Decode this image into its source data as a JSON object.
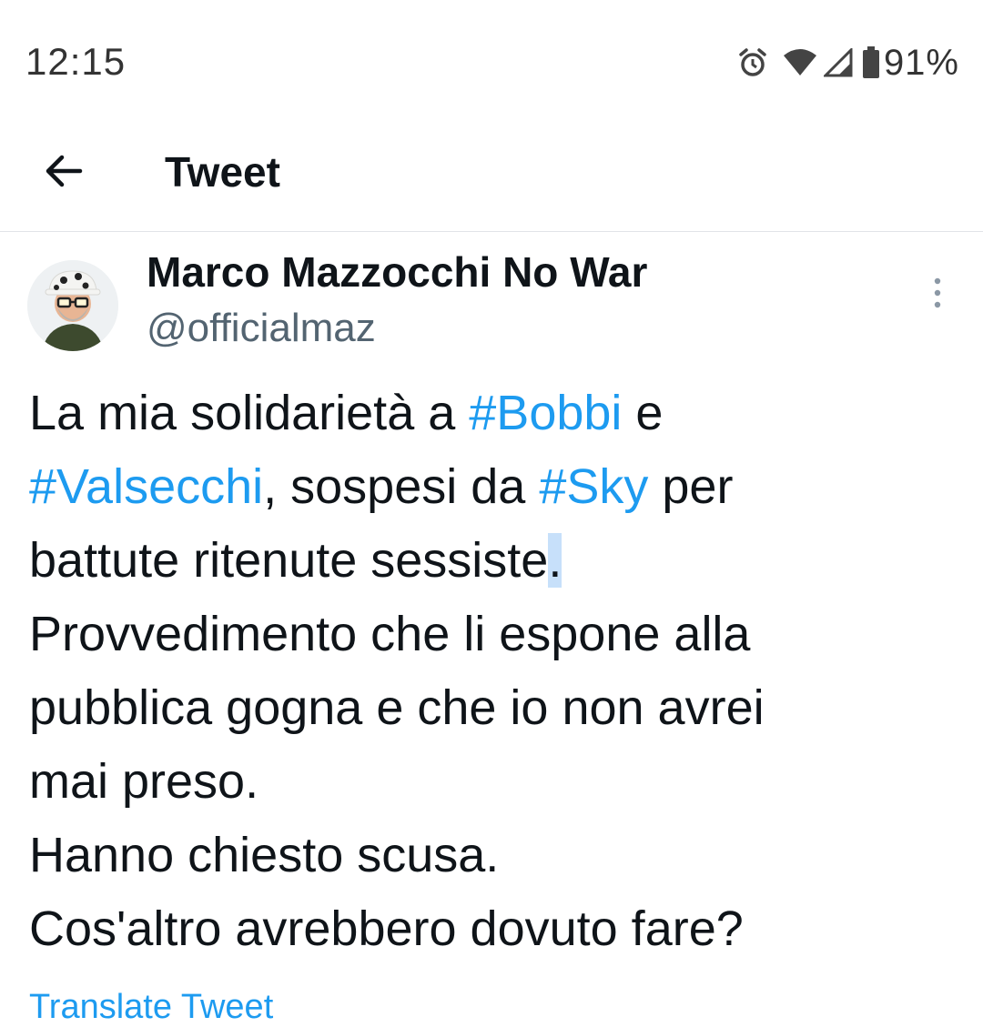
{
  "status_bar": {
    "time": "12:15",
    "battery_percent": "91%",
    "icons": [
      "alarm-icon",
      "wifi-icon",
      "signal-icon",
      "battery-icon"
    ]
  },
  "header": {
    "back_icon": "arrow-left-icon",
    "title": "Tweet"
  },
  "tweet": {
    "author": {
      "display_name": "Marco Mazzocchi No War",
      "handle": "@officialmaz"
    },
    "more_icon": "more-vertical-icon",
    "text": {
      "l1_a": "La mia solidarietà a ",
      "tag_bobbi": "#Bobbi",
      "l1_b": " e",
      "tag_valsecchi": "#Valsecchi",
      "l2_a": ", sospesi da ",
      "tag_sky": "#Sky",
      "l2_b": " per",
      "l3_a": "battute ritenute sessiste",
      "l3_sel": ".",
      "l4": "Provvedimento che li espone alla",
      "l5": "pubblica gogna e che io non avrei",
      "l6": "mai preso.",
      "l7": "Hanno chiesto scusa.",
      "l8": "Cos'altro avrebbero dovuto fare?"
    },
    "translate_label": "Translate Tweet"
  },
  "colors": {
    "link": "#1d9bf0",
    "text": "#0f1419",
    "secondary": "#536471",
    "selection": "#c7e0fa",
    "divider": "#e1e4e8"
  }
}
